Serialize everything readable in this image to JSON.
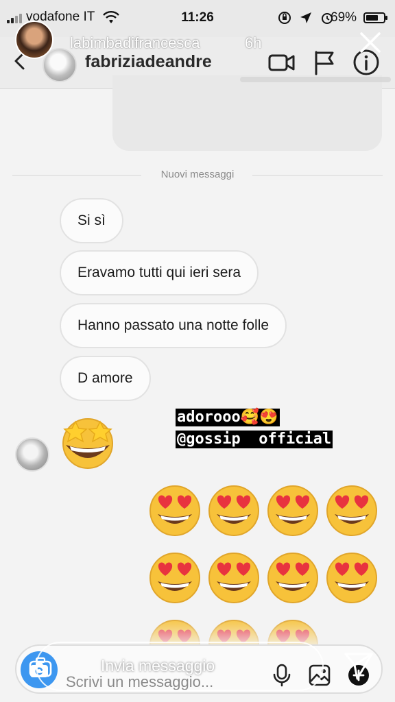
{
  "status_bar": {
    "carrier": "vodafone IT",
    "time": "11:26",
    "battery_percent": "69%",
    "battery_level": 0.69,
    "icons": [
      "signal-icon",
      "wifi-icon",
      "alarm-icon",
      "location-icon",
      "rotation-lock-icon",
      "battery-icon"
    ]
  },
  "story": {
    "username": "labimbadifrancesca",
    "time_ago": "6h",
    "caption_line1": "adorooo🥰😍",
    "caption_line2": "@gossip  official",
    "reply_placeholder": "Invia messaggio"
  },
  "chat": {
    "username": "fabriziadeandre",
    "divider_label": "Nuovi messaggi",
    "messages": [
      "Si sì",
      "Eravamo tutti qui ieri sera",
      "Hanno passato una notte folle",
      "D amore"
    ],
    "composer_placeholder": "Scrivi un messaggio..."
  },
  "colors": {
    "background": "#f3f3f3",
    "camera_button": "#3d97f0",
    "bubble_border": "#e2e2e2",
    "emoji_yellow": "#f7c23a",
    "heart_red": "#e8333f"
  }
}
